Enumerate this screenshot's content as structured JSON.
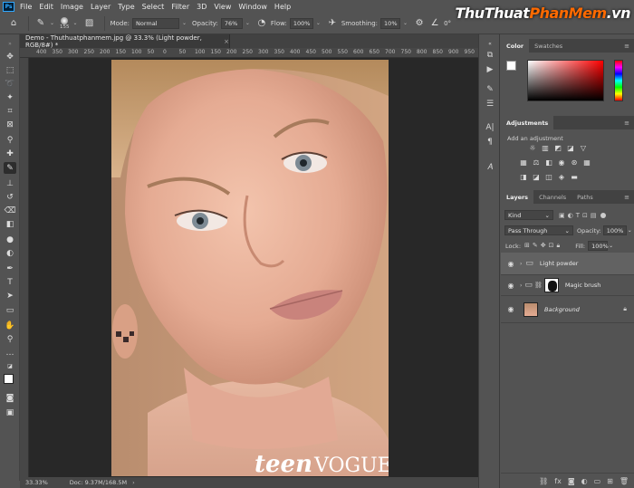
{
  "app": {
    "logo": "Ps"
  },
  "menubar": [
    "File",
    "Edit",
    "Image",
    "Layer",
    "Type",
    "Select",
    "Filter",
    "3D",
    "View",
    "Window",
    "Help"
  ],
  "watermark": {
    "part1": "ThuThuat",
    "part2": "PhanMem",
    "part3": ".vn"
  },
  "options": {
    "brush_size": "155",
    "mode_label": "Mode:",
    "mode_value": "Normal",
    "opacity_label": "Opacity:",
    "opacity_value": "76%",
    "flow_label": "Flow:",
    "flow_value": "100%",
    "smoothing_label": "Smoothing:",
    "smoothing_value": "10%",
    "angle_value": "0°"
  },
  "document": {
    "tab_title": "Demo - Thuthuatphanmem.jpg @ 33.3% (Light powder, RGB/8#) *",
    "ruler_ticks": [
      "400",
      "350",
      "300",
      "250",
      "200",
      "150",
      "100",
      "50",
      "0",
      "50",
      "100",
      "150",
      "200",
      "250",
      "300",
      "350",
      "400",
      "450",
      "500",
      "550",
      "600",
      "650",
      "700",
      "750",
      "800",
      "850",
      "900",
      "950",
      "1000"
    ],
    "photo_caption": "teenVOGUE",
    "photo_caption_a": "teen",
    "photo_caption_b": "VOGUE"
  },
  "status": {
    "zoom": "33.33%",
    "doc": "Doc: 9.37M/168.5M"
  },
  "color_panel": {
    "tabs": [
      "Color",
      "Swatches"
    ],
    "fg": "#ffffff",
    "bg": "#000000"
  },
  "adjustments_panel": {
    "title": "Adjustments",
    "add_label": "Add an adjustment"
  },
  "layers_panel": {
    "tabs": [
      "Layers",
      "Channels",
      "Paths"
    ],
    "filter_kind": "Kind",
    "blend_mode": "Pass Through",
    "opacity_label": "Opacity:",
    "opacity_value": "100%",
    "lock_label": "Lock:",
    "fill_label": "Fill:",
    "fill_value": "100%",
    "layers": [
      {
        "name": "Light powder",
        "type": "group",
        "visible": true,
        "selected": true
      },
      {
        "name": "Magic brush",
        "type": "group-masked",
        "visible": true,
        "selected": false
      },
      {
        "name": "Background",
        "type": "image",
        "visible": true,
        "selected": false,
        "locked": true
      }
    ]
  }
}
